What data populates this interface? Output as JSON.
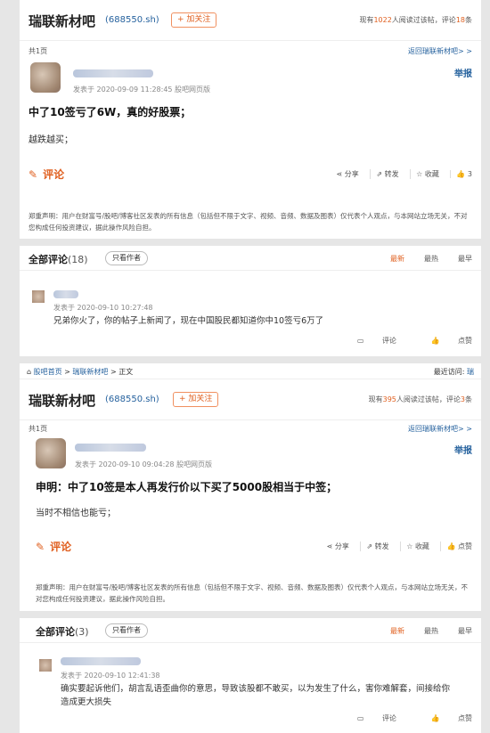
{
  "post1": {
    "forum_title": "瑞联新材吧",
    "stock_code": "(688550.sh)",
    "follow_label": "+ 加关注",
    "stats_prefix": "现有",
    "readers": "1022",
    "stats_mid": "人阅读过该帖，评论",
    "comment_count": "18",
    "stats_suffix": "条",
    "page_count": "共1页",
    "back_link": "返回瑞联新材吧> >",
    "report": "举报",
    "posted": "发表于 2020-09-09 11:28:45 股吧网页版",
    "heading": "中了10签亏了6W，真的好股票；",
    "body": "越跌越买；",
    "comment_btn": "评论",
    "actions": {
      "share": "分享",
      "repost": "转发",
      "favorite": "收藏",
      "like": "3"
    },
    "disclaimer": "郑重声明：用户在财富号/股吧/博客社区发表的所有信息（包括但不限于文字、视频、音频、数据及图表）仅代表个人观点，与本网站立场无关，不对您构成任何投资建议，据此操作风险自担。",
    "tabs": {
      "all_label": "全部评论",
      "all_count": "(18)",
      "only_author": "只看作者",
      "newest": "最新",
      "hottest": "最热",
      "earliest": "最早"
    },
    "comment": {
      "posted": "发表于 2020-09-10 10:27:48",
      "text": "兄弟你火了，你的帖子上新闻了，现在中国股民都知道你中10签亏6万了",
      "reply": "评论",
      "like": "点赞"
    }
  },
  "post2": {
    "breadcrumb": {
      "home": "股吧首页",
      "forum": "瑞联新材吧",
      "current": "正文",
      "sep": ">"
    },
    "recent_label": "最近访问:",
    "recent_value": "瑞",
    "forum_title": "瑞联新材吧",
    "stock_code": "(688550.sh)",
    "follow_label": "+ 加关注",
    "stats_prefix": "现有",
    "readers": "395",
    "stats_mid": "人阅读过该帖，评论",
    "comment_count": "3",
    "stats_suffix": "条",
    "page_count": "共1页",
    "back_link": "返回瑞联新材吧> >",
    "report": "举报",
    "posted": "发表于 2020-09-10 09:04:28 股吧网页版",
    "heading": "申明：中了10签是本人再发行价以下买了5000股相当于中签；",
    "body": "当时不相信也能亏；",
    "comment_btn": "评论",
    "actions": {
      "share": "分享",
      "repost": "转发",
      "favorite": "收藏",
      "like": "点赞"
    },
    "disclaimer": "郑重声明：用户在财富号/股吧/博客社区发表的所有信息（包括但不限于文字、视频、音频、数据及图表）仅代表个人观点，与本网站立场无关，不对您构成任何投资建议，据此操作风险自担。",
    "tabs": {
      "all_label": "全部评论",
      "all_count": "(3)",
      "only_author": "只看作者",
      "newest": "最新",
      "hottest": "最热",
      "earliest": "最早"
    },
    "comment": {
      "posted": "发表于 2020-09-10 12:41:38",
      "line1": "确实要起诉他们，胡言乱语歪曲你的意思，导致该股都不敢买，以为发生了什么，害你难解套，间接给你",
      "line2": "造成更大损失",
      "reply": "评论",
      "like": "点赞"
    }
  },
  "colors": {
    "accent": "#e06020",
    "link": "#26629e"
  }
}
